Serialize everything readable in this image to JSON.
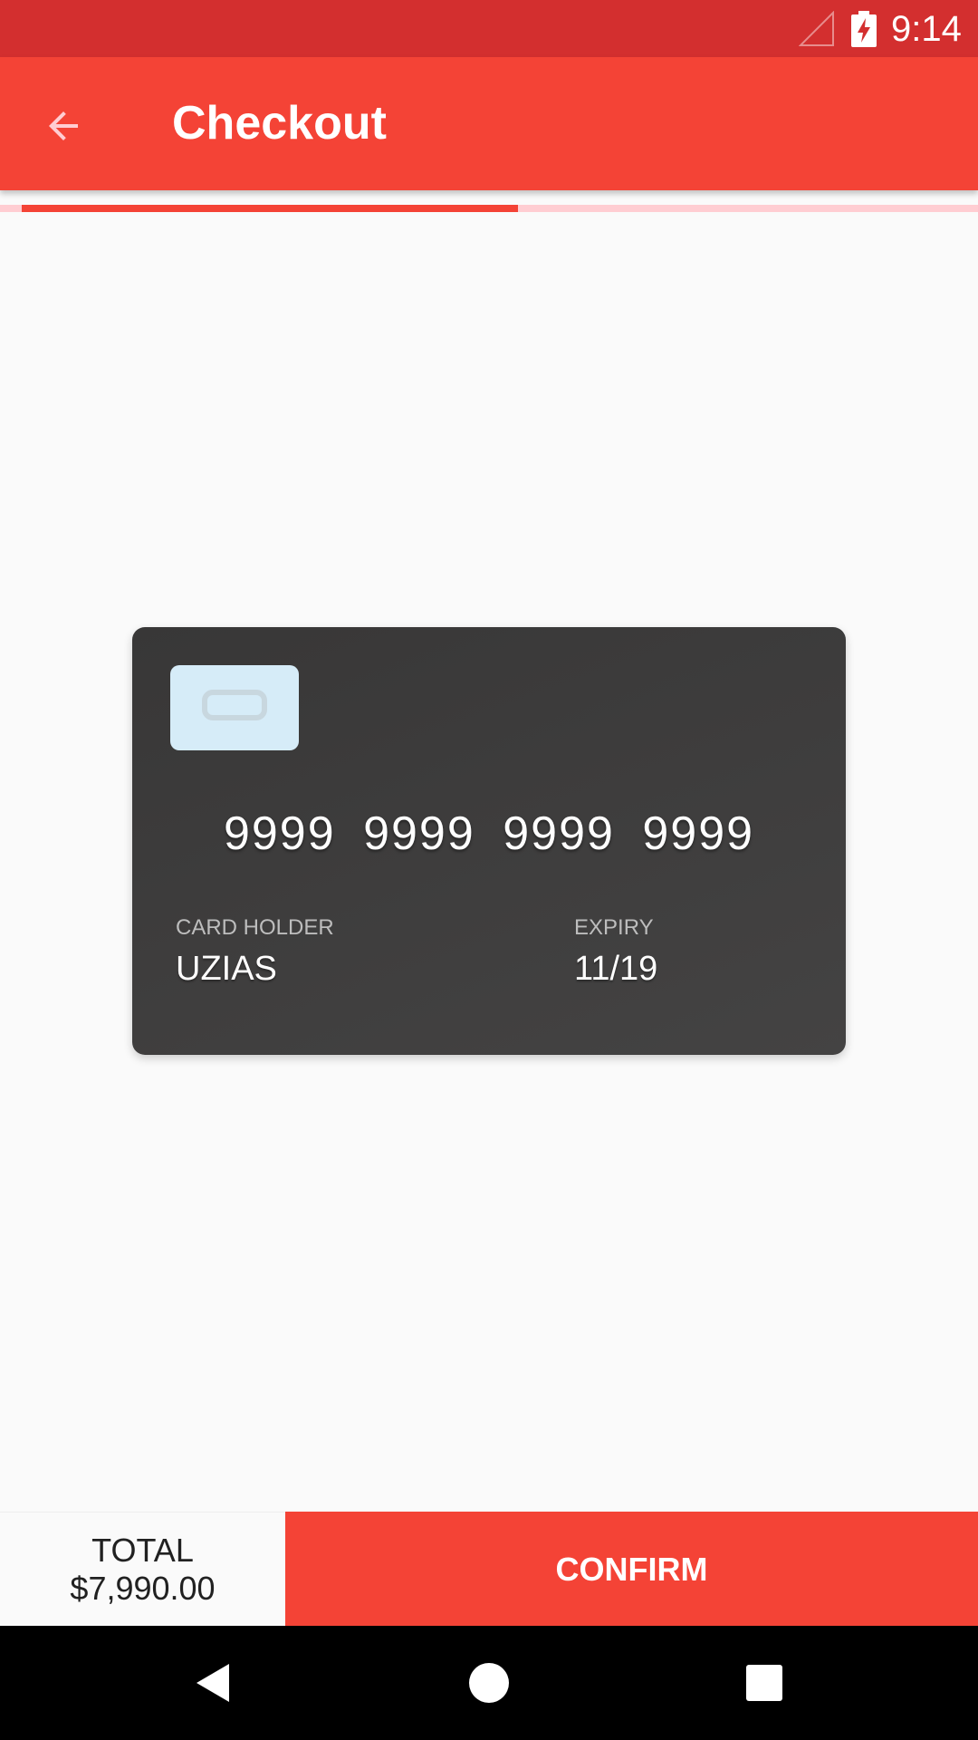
{
  "status_bar": {
    "time": "9:14",
    "icons": [
      "signal-icon",
      "battery-charging-icon"
    ]
  },
  "app_bar": {
    "back_icon": "arrow-back-icon",
    "title": "Checkout"
  },
  "progress": {
    "fraction": 0.53
  },
  "card": {
    "number": "9999 9999 9999 9999",
    "holder_label": "CARD HOLDER",
    "holder_name": "UZIAS",
    "expiry_label": "EXPIRY",
    "expiry_value": "11/19"
  },
  "bottom_bar": {
    "total_label": "TOTAL",
    "total_amount": "$7,990.00",
    "confirm_label": "CONFIRM"
  },
  "nav_bar": {
    "icons": [
      "back-triangle-icon",
      "home-circle-icon",
      "recents-square-icon"
    ]
  },
  "colors": {
    "primary": "#f44336",
    "primary_dark": "#d32f2f",
    "progress_track": "#ffcdd2",
    "card_background": "#3d3c3c",
    "chip": "#d6ecf8"
  }
}
